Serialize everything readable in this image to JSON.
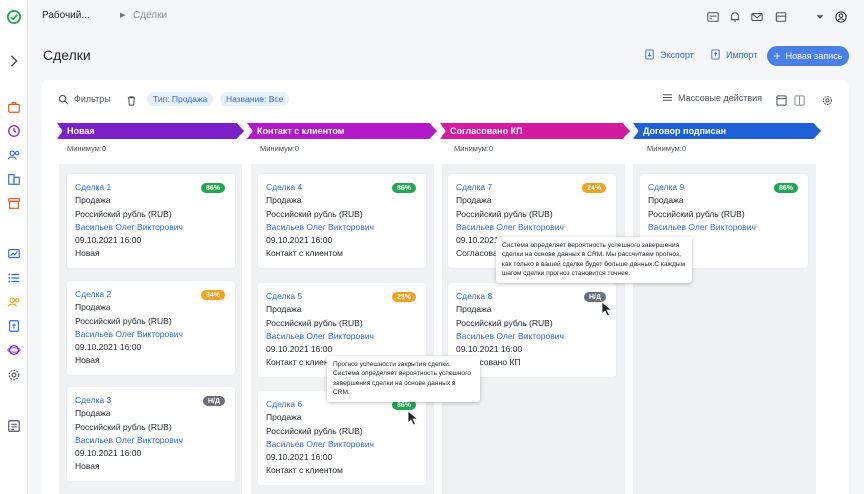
{
  "breadcrumb": {
    "root": "Рабочий...",
    "current": "Сделки"
  },
  "page": {
    "title": "Сделки"
  },
  "header": {
    "export_label": "Экспорт",
    "import_label": "Импорт",
    "new_record_label": "Новая запись"
  },
  "filters": {
    "label": "Фильтры",
    "chips": [
      "Тип: Продажа",
      "Название: Все"
    ],
    "bulk_actions_label": "Массовые действия"
  },
  "stages": [
    {
      "name": "Новая",
      "minimum": "Минимум:0",
      "color": "#7b1fc9"
    },
    {
      "name": "Контакт с клиентом",
      "minimum": "Минимум:0",
      "color": "#b318c9"
    },
    {
      "name": "Согласовано КП",
      "minimum": "Минимум:0",
      "color": "#d41a9e"
    },
    {
      "name": "Договор подписан",
      "minimum": "Минимум:0",
      "color": "#1c5fd6"
    }
  ],
  "cards": [
    {
      "title": "Сделка 1",
      "badge": "86%",
      "badge_color": "green",
      "type": "Продажа",
      "currency": "Российский рубль (RUB)",
      "owner": "Васильев Олег Викторович",
      "date": "09.10.2021 16:00",
      "stage": "Новая"
    },
    {
      "title": "Сделка 2",
      "badge": "34%",
      "badge_color": "orange",
      "type": "Продажа",
      "currency": "Российский рубль (RUB)",
      "owner": "Васильев Олег Викторович",
      "date": "09.10.2021 16:00",
      "stage": "Новая"
    },
    {
      "title": "Сделка 3",
      "badge": "Н/Д",
      "badge_color": "gray",
      "type": "Продажа",
      "currency": "Российский рубль (RUB)",
      "owner": "Васильев Олег Викторович",
      "date": "09.10.2021 16:00",
      "stage": "Новая"
    },
    {
      "title": "Сделка 4",
      "badge": "86%",
      "badge_color": "green",
      "type": "Продажа",
      "currency": "Российский рубль (RUB)",
      "owner": "Васильев Олег Викторович",
      "date": "09.10.2021 16:00",
      "stage": "Контакт с клиентом"
    },
    {
      "title": "Сделка 5",
      "badge": "28%",
      "badge_color": "orange",
      "type": "Продажа",
      "currency": "Российский рубль (RUB)",
      "owner": "Васильев Олег Викторович",
      "date": "09.10.2021 16:00",
      "stage": "Контакт с клиент"
    },
    {
      "title": "Сделка 6",
      "badge": "86%",
      "badge_color": "green",
      "type": "Продажа",
      "currency": "Российский рубль (RUB)",
      "owner": "Васильев Олег Викторович",
      "date": "09.10.2021 16:00",
      "stage": "Контакт с клиентом"
    },
    {
      "title": "Сделка 7",
      "badge": "24%",
      "badge_color": "orange",
      "type": "Продажа",
      "currency": "Российский рубль (RUB)",
      "owner": "Васильев Олег Викторович",
      "date": "09.10.2021 16:00",
      "stage": "Согласова"
    },
    {
      "title": "Сделка 8",
      "badge": "Н/Д",
      "badge_color": "gray",
      "type": "Продажа",
      "currency": "Российский рубль (RUB)",
      "owner": "Васильев Олег Викторович",
      "date": "09.10.2021 16:00",
      "stage": "Согласовано КП"
    },
    {
      "title": "Сделка 9",
      "badge": "86%",
      "badge_color": "green",
      "type": "Продажа",
      "currency": "Российский рубль (RUB)",
      "owner": "Васильев Олег Викторович",
      "date": "16:00",
      "stage": "исан"
    }
  ],
  "tooltips": {
    "prob_na": "Система определяет вероятность успешного завершения сделки на основе данных в CRM. Мы рассчитаем прогноз, как только в вашей сделке будет больше данных.С каждым шагом сделки прогноз становится точнее.",
    "prob_title": "Прогноз успешности закрытия сделки.",
    "prob_body": "Система определяет вероятность успешного завершения сделки на основе данных в CRM."
  }
}
